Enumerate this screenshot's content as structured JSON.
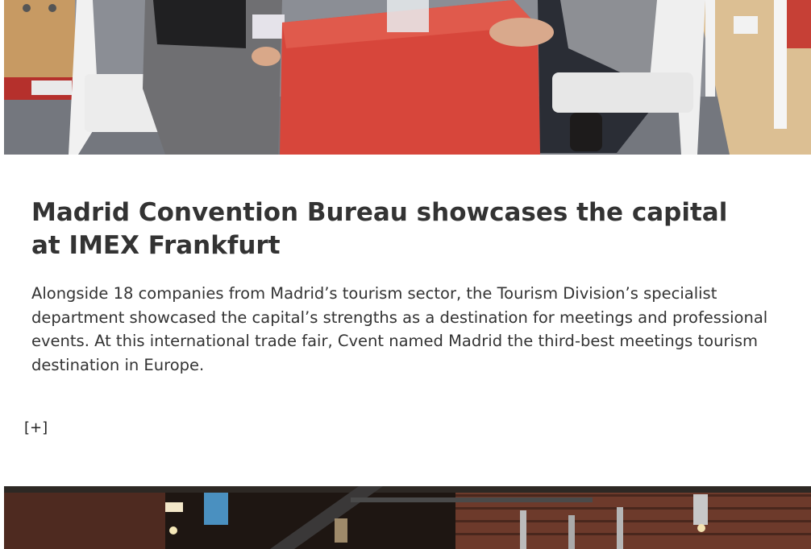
{
  "top_photo": {
    "alt_icon": "photo-icon",
    "colors": {
      "red_lectern": "#d43c33",
      "carpet": "#7c7f86",
      "floor": "#d9b98c"
    }
  },
  "article": {
    "title": "Madrid Convention Bureau showcases the capital at IMEX Frankfurt",
    "body": "Alongside 18 companies from Madrid’s tourism sector, the Tourism Division’s specialist department showcased the capital’s strengths as a destination for meetings and professional events. At this international trade fair, Cvent named Madrid the third-best meetings tourism destination in Europe.",
    "more_label": "[+]"
  },
  "bottom_photo": {
    "alt_icon": "photo-icon",
    "colors": {
      "brick": "#7a3e2c",
      "dark": "#1c1410"
    }
  }
}
